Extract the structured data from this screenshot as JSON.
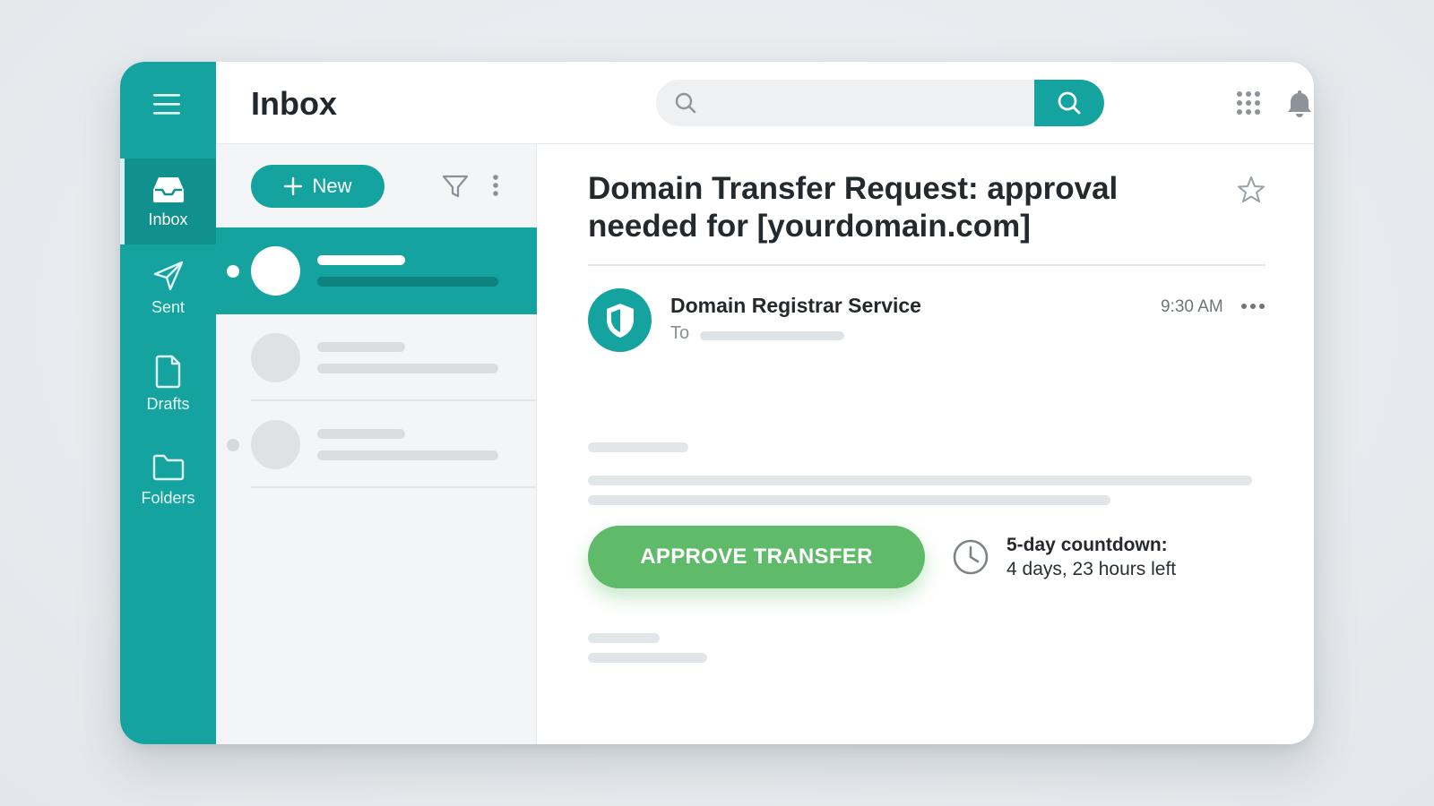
{
  "header": {
    "title": "Inbox",
    "search_placeholder": "",
    "icons": [
      "menu-icon",
      "search-icon",
      "apps-grid-icon",
      "bell-icon"
    ]
  },
  "sidebar": {
    "items": [
      {
        "label": "Inbox",
        "icon": "inbox-tray-icon",
        "active": true
      },
      {
        "label": "Sent",
        "icon": "paper-plane-icon",
        "active": false
      },
      {
        "label": "Drafts",
        "icon": "document-icon",
        "active": false
      },
      {
        "label": "Folders",
        "icon": "folder-icon",
        "active": false
      }
    ]
  },
  "list": {
    "new_label": "New",
    "icons": [
      "plus-icon",
      "filter-icon",
      "kebab-menu-icon"
    ]
  },
  "message": {
    "subject": "Domain Transfer Request: approval needed for [yourdomain.com]",
    "sender": "Domain Registrar Service",
    "to_label": "To",
    "time": "9:30 AM",
    "approve_label": "APPROVE TRANSFER",
    "countdown_title": "5-day countdown:",
    "countdown_detail": "4 days, 23 hours left"
  },
  "colors": {
    "accent": "#14a39f",
    "approve": "#5fba6a",
    "background": "#e6eaee"
  }
}
